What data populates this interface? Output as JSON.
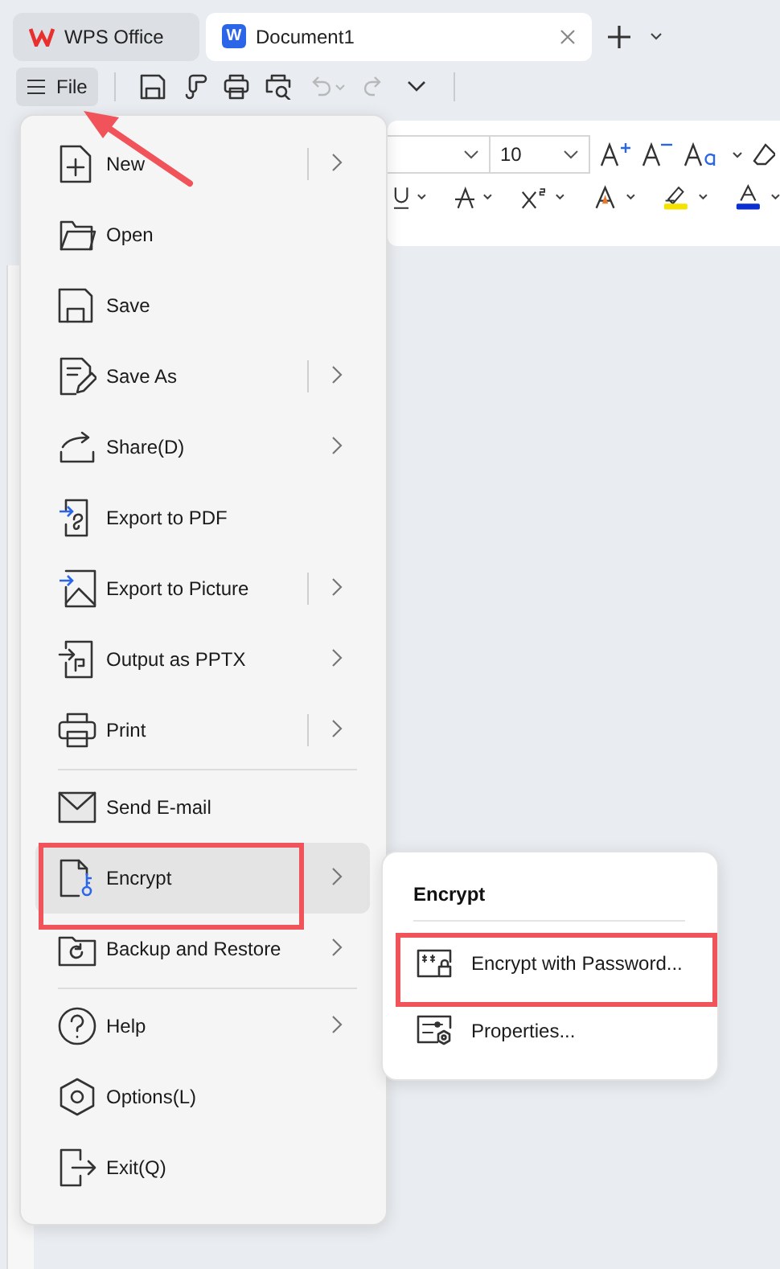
{
  "tabs": [
    {
      "label": "WPS Office",
      "kind": "home",
      "selected": false
    },
    {
      "label": "Document1",
      "kind": "document",
      "icon_letter": "W",
      "selected": true
    }
  ],
  "toolbar": {
    "file_label": "File",
    "undo": {
      "disabled": true
    },
    "redo": {
      "disabled": true
    }
  },
  "ribbon": {
    "font_size": "10"
  },
  "file_menu": {
    "sections": [
      {
        "items": [
          {
            "label": "New",
            "submenu": true,
            "split": true,
            "selected": false
          },
          {
            "label": "Open",
            "submenu": false,
            "split": false,
            "selected": false
          },
          {
            "label": "Save",
            "submenu": false,
            "split": false,
            "selected": false
          },
          {
            "label": "Save As",
            "submenu": true,
            "split": true,
            "selected": false
          },
          {
            "label": "Share(D)",
            "submenu": true,
            "split": false,
            "selected": false
          },
          {
            "label": "Export to PDF",
            "submenu": false,
            "split": false,
            "selected": false
          },
          {
            "label": "Export to Picture",
            "submenu": true,
            "split": true,
            "selected": false
          },
          {
            "label": "Output as PPTX",
            "submenu": true,
            "split": false,
            "selected": false
          },
          {
            "label": "Print",
            "submenu": true,
            "split": true,
            "selected": false
          }
        ]
      },
      {
        "items": [
          {
            "label": "Send E-mail",
            "submenu": false,
            "split": false,
            "selected": false
          },
          {
            "label": "Encrypt",
            "submenu": true,
            "split": false,
            "selected": true
          },
          {
            "label": "Backup and Restore",
            "submenu": true,
            "split": false,
            "selected": false
          }
        ]
      },
      {
        "items": [
          {
            "label": "Help",
            "submenu": true,
            "split": false,
            "selected": false
          },
          {
            "label": "Options(L)",
            "submenu": false,
            "split": false,
            "selected": false
          },
          {
            "label": "Exit(Q)",
            "submenu": false,
            "split": false,
            "selected": false
          }
        ]
      }
    ]
  },
  "submenu": {
    "title": "Encrypt",
    "items": [
      {
        "label": "Encrypt with Password..."
      },
      {
        "label": "Properties..."
      }
    ]
  }
}
